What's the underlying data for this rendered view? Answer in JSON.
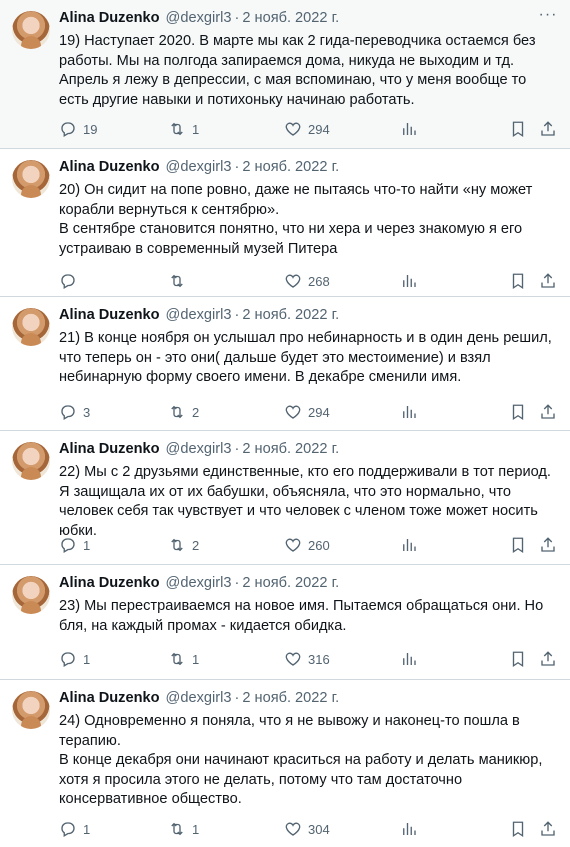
{
  "tweets": [
    {
      "name": "Alina Duzenko",
      "handle": "@dexgirl3",
      "separator": "·",
      "date": "2 нояб. 2022 г.",
      "text": "19) Наступает 2020. В марте мы как 2 гида-переводчика остаемся без работы. Мы на полгода запираемся дома, никуда не выходим и тд.\nАпрель я лежу в депрессии, с мая вспоминаю, что у меня вообще то есть другие навыки и потихоньку начинаю работать.",
      "replies": "19",
      "retweets": "1",
      "likes": "294"
    },
    {
      "name": "Alina Duzenko",
      "handle": "@dexgirl3",
      "separator": "·",
      "date": "2 нояб. 2022 г.",
      "text": "20) Он сидит на попе ровно, даже не пытаясь что-то найти «ну может корабли вернуться к сентябрю».\nВ сентябре становится понятно, что ни хера и через знакомую я его устраиваю в современный музей Питера",
      "replies": "",
      "retweets": "",
      "likes": "268"
    },
    {
      "name": "Alina Duzenko",
      "handle": "@dexgirl3",
      "separator": "·",
      "date": "2 нояб. 2022 г.",
      "text": "21) В конце ноября он услышал про небинарность и в один день решил, что теперь он - это они( дальше будет это местоимение) и взял небинарную форму своего имени. В декабре сменили имя.",
      "replies": "3",
      "retweets": "2",
      "likes": "294"
    },
    {
      "name": "Alina Duzenko",
      "handle": "@dexgirl3",
      "separator": "·",
      "date": "2 нояб. 2022 г.",
      "text": "22) Мы с 2 друзьями единственные, кто его поддерживали в тот период. Я защищала их от их бабушки, объясняла, что это нормально, что человек себя так чувствует и что человек с членом тоже может носить юбки.",
      "replies": "1",
      "retweets": "2",
      "likes": "260"
    },
    {
      "name": "Alina Duzenko",
      "handle": "@dexgirl3",
      "separator": "·",
      "date": "2 нояб. 2022 г.",
      "text": "23) Мы перестраиваемся на новое имя. Пытаемся обращаться они. Но бля, на каждый промах - кидается обидка.",
      "replies": "1",
      "retweets": "1",
      "likes": "316"
    },
    {
      "name": "Alina Duzenko",
      "handle": "@dexgirl3",
      "separator": "·",
      "date": "2 нояб. 2022 г.",
      "text": "24) Одновременно я поняла, что я не вывожу и наконец-то пошла в терапию.\nВ конце декабря они начинают краситься на работу и делать маникюр, хотя я просила этого не делать, потому что там достаточно консервативное общество.",
      "replies": "1",
      "retweets": "1",
      "likes": "304"
    }
  ],
  "icons": {
    "more": "more-icon",
    "reply": "reply-icon",
    "retweet": "retweet-icon",
    "like": "heart-icon",
    "views": "views-icon",
    "bookmark": "bookmark-icon",
    "share": "share-icon"
  },
  "colors": {
    "text": "#0f1419",
    "muted": "#536471",
    "border": "#cfd9de",
    "highlight": "#f7f9f9"
  }
}
